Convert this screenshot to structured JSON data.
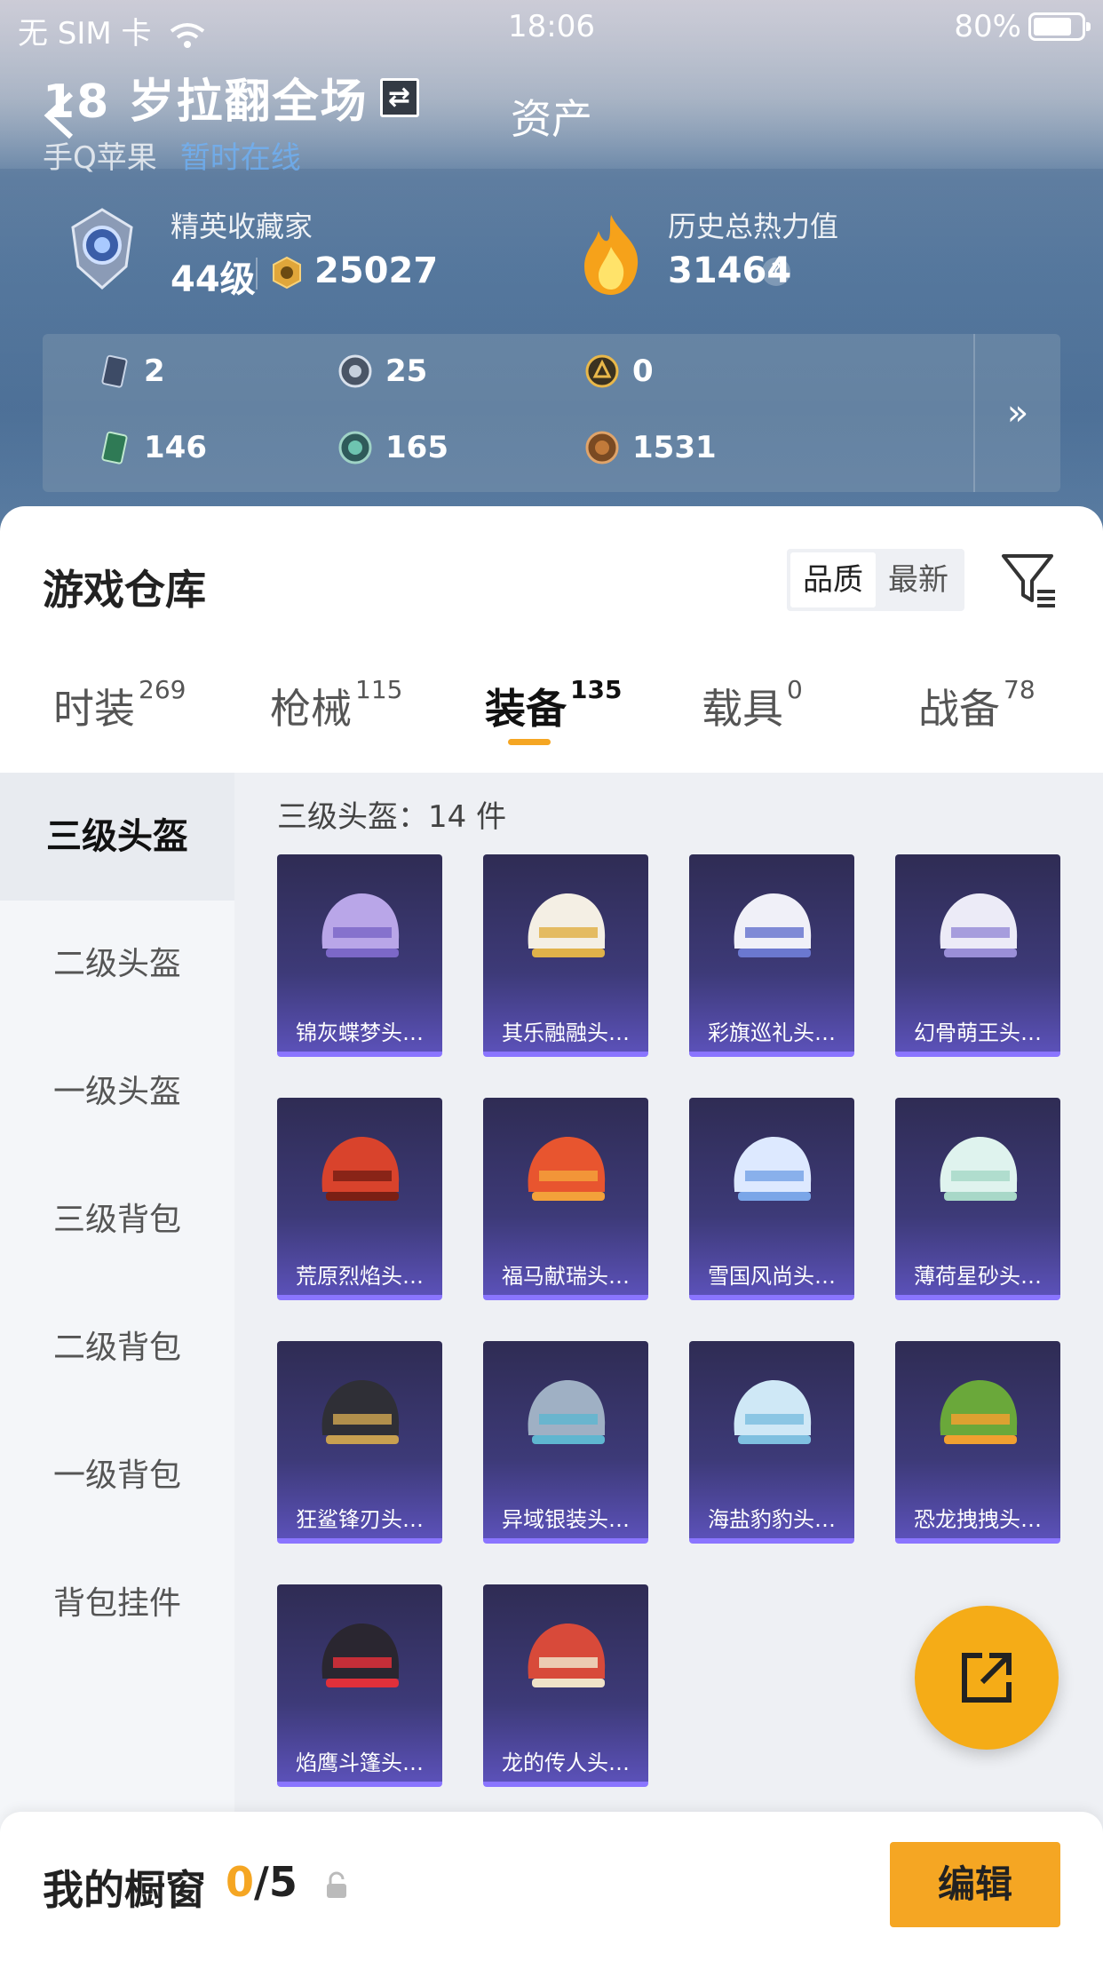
{
  "status_bar": {
    "carrier": "无 SIM 卡",
    "time": "18:06",
    "battery": "80%"
  },
  "header": {
    "user_name": "18 岁拉翻全场",
    "page_title": "资产",
    "platform": "手Q苹果",
    "online_status": "暂时在线"
  },
  "profile": {
    "rank_title": "精英收藏家",
    "level": "44级",
    "coins": "25027",
    "heat_label": "历史总热力值",
    "heat_value": "31464",
    "help_symbol": "?"
  },
  "stats": {
    "items": [
      {
        "value": "2",
        "icon": "card-icon"
      },
      {
        "value": "25",
        "icon": "silver-medal-icon"
      },
      {
        "value": "0",
        "icon": "gold-badge-icon"
      },
      {
        "value": "146",
        "icon": "green-card-icon"
      },
      {
        "value": "165",
        "icon": "orb-icon"
      },
      {
        "value": "1531",
        "icon": "bronze-coin-icon"
      }
    ],
    "more_symbol": "»"
  },
  "warehouse": {
    "title": "游戏仓库",
    "sort_options": [
      "品质",
      "最新"
    ],
    "tabs": [
      {
        "label": "时装",
        "count": "269"
      },
      {
        "label": "枪械",
        "count": "115"
      },
      {
        "label": "装备",
        "count": "135"
      },
      {
        "label": "载具",
        "count": "0"
      },
      {
        "label": "战备",
        "count": "78"
      }
    ],
    "categories": [
      "三级头盔",
      "二级头盔",
      "一级头盔",
      "三级背包",
      "二级背包",
      "一级背包",
      "背包挂件"
    ],
    "section_label": "三级头盔：14 件",
    "items": [
      "锦灰蝶梦头…",
      "其乐融融头…",
      "彩旗巡礼头…",
      "幻骨萌王头…",
      "荒原烈焰头…",
      "福马献瑞头…",
      "雪国风尚头…",
      "薄荷星砂头…",
      "狂鲨锋刃头…",
      "异域银装头…",
      "海盐豹豹头…",
      "恐龙拽拽头…",
      "焰鹰斗篷头…",
      "龙的传人头…"
    ]
  },
  "showcase": {
    "label": "我的橱窗",
    "current": "0",
    "total": "/5",
    "edit": "编辑"
  },
  "colors": {
    "accent": "#f5a623",
    "card_bg": "#3d3a78",
    "card_border": "#8a75ff"
  }
}
